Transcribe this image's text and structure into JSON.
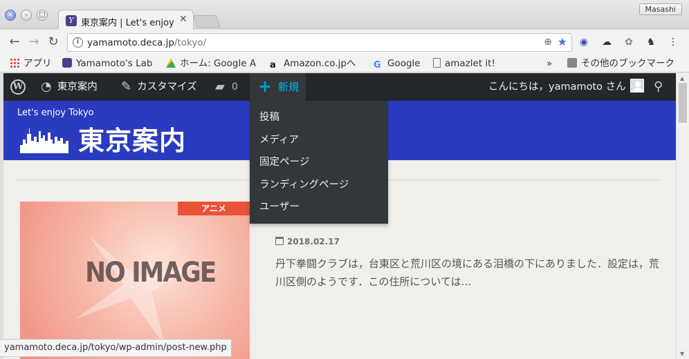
{
  "window": {
    "profile_name": "Masashi"
  },
  "tab": {
    "title": "東京案内 | Let's enjoy Tokyo"
  },
  "address_bar": {
    "url_host": "yamamoto.deca.jp",
    "url_path": "/tokyo/"
  },
  "bookmarks": [
    {
      "label": "アプリ",
      "icon": "apps-grid-icon"
    },
    {
      "label": "Yamamoto's Lab",
      "icon": "site-favicon-icon"
    },
    {
      "label": "ホーム: Google A",
      "icon": "google-drive-icon"
    },
    {
      "label": "Amazon.co.jpへ",
      "icon": "amazon-icon"
    },
    {
      "label": "Google",
      "icon": "google-icon"
    },
    {
      "label": "amazlet it!",
      "icon": "page-icon"
    },
    {
      "label": "»",
      "icon": ""
    },
    {
      "label": "その他のブックマーク",
      "icon": "folder-icon"
    }
  ],
  "adminbar": {
    "site_name": "東京案内",
    "customize": "カスタマイズ",
    "comments_count": "0",
    "new_label": "新規",
    "greeting": "こんにちは，yamamoto さん"
  },
  "new_menu": {
    "items": [
      "投稿",
      "メディア",
      "固定ページ",
      "ランディングページ",
      "ユーザー"
    ]
  },
  "site": {
    "tagline": "Let's enjoy Tokyo",
    "title": "東京案内"
  },
  "post": {
    "category": "アニメ",
    "thumbnail_text": "NO IMAGE",
    "date": "2018.02.17",
    "excerpt": "丹下拳闘クラブは，台東区と荒川区の境にある泪橋の下にありました．設定は，荒川区側のようです．この住所については..."
  },
  "status_url": "yamamoto.deca.jp/tokyo/wp-admin/post-new.php",
  "colors": {
    "admin_bar": "#23282d",
    "header_blue": "#2b3bbf",
    "accent": "#00b9eb",
    "category_badge": "#e8533a"
  }
}
